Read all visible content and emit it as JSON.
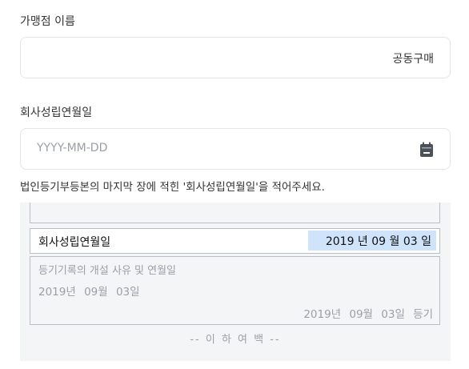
{
  "store_name": {
    "label": "가맹점 이름",
    "value": "공동구매"
  },
  "founding_date": {
    "label": "회사성립연월일",
    "placeholder": "YYYY-MM-DD",
    "icon": "calendar-icon"
  },
  "help_text": "법인등기부등본의 마지막 장에 적힌 '회사성립연월일'을 적어주세요.",
  "document_example": {
    "row_label": "회사성립연월일",
    "row_date": "2019 년 09 월 03 일",
    "registry_title": "등기기록의 개설 사유 및 연월일",
    "registry_date": "2019년 09월 03일",
    "registry_date_right": "2019년 09월 03일 등기",
    "end_marker": "-- 이 하 여 백 --",
    "highlight_color": "#cfe3fb"
  }
}
